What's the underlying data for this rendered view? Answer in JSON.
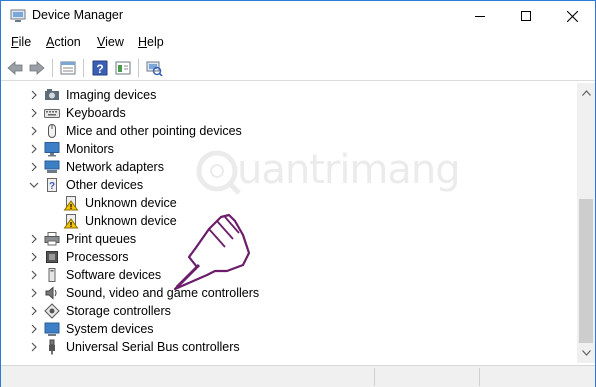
{
  "window": {
    "title": "Device Manager",
    "icon": "device-manager-icon"
  },
  "controls": {
    "minimize_icon": "minimize-icon",
    "maximize_icon": "maximize-icon",
    "close_icon": "close-icon"
  },
  "menu": {
    "file": {
      "u": "F",
      "rest": "ile"
    },
    "action": {
      "u": "A",
      "rest": "ction"
    },
    "view": {
      "u": "V",
      "rest": "iew"
    },
    "help": {
      "u": "H",
      "rest": "elp"
    }
  },
  "toolbar": {
    "buttons": [
      "back-icon",
      "forward-icon",
      "properties-icon",
      "help-icon",
      "show-hidden-icon",
      "scan-hardware-icon"
    ]
  },
  "tree": {
    "items": [
      {
        "label": "Imaging devices",
        "icon": "camera-icon",
        "expanded": false
      },
      {
        "label": "Keyboards",
        "icon": "keyboard-icon",
        "expanded": false
      },
      {
        "label": "Mice and other pointing devices",
        "icon": "mouse-icon",
        "expanded": false
      },
      {
        "label": "Monitors",
        "icon": "monitor-icon",
        "expanded": false
      },
      {
        "label": "Network adapters",
        "icon": "network-adapter-icon",
        "expanded": false
      },
      {
        "label": "Other devices",
        "icon": "other-devices-icon",
        "expanded": true
      },
      {
        "label": "Unknown device",
        "icon": "unknown-device-warning-icon",
        "child": true
      },
      {
        "label": "Unknown device",
        "icon": "unknown-device-warning-icon",
        "child": true
      },
      {
        "label": "Print queues",
        "icon": "printer-icon",
        "expanded": false
      },
      {
        "label": "Processors",
        "icon": "processor-icon",
        "expanded": false
      },
      {
        "label": "Software devices",
        "icon": "software-device-icon",
        "expanded": false
      },
      {
        "label": "Sound, video and game controllers",
        "icon": "speaker-icon",
        "expanded": false
      },
      {
        "label": "Storage controllers",
        "icon": "storage-controller-icon",
        "expanded": false
      },
      {
        "label": "System devices",
        "icon": "system-device-icon",
        "expanded": false
      },
      {
        "label": "Universal Serial Bus controllers",
        "icon": "usb-icon",
        "expanded": false
      }
    ]
  },
  "watermark": {
    "text": "uantrimang",
    "logo": "quantrimang-logo"
  },
  "colors": {
    "window_border": "#2b7ad6",
    "warning": "#f5c400"
  }
}
